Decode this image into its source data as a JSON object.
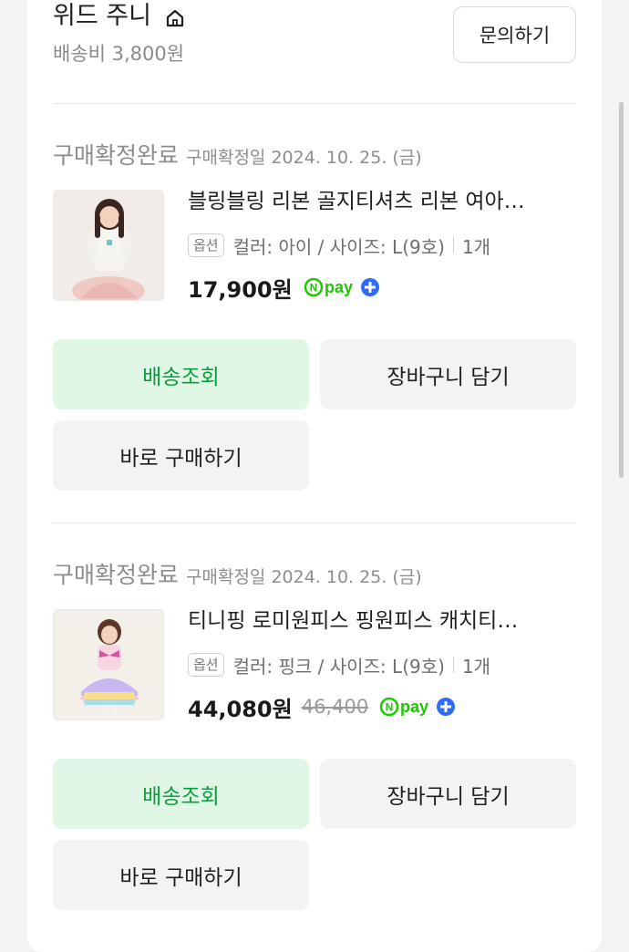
{
  "seller": {
    "name": "위드 주니",
    "shipping_fee": "배송비 3,800원",
    "inquiry_label": "문의하기"
  },
  "orders": [
    {
      "status_label": "구매확정완료",
      "status_date": "구매확정일 2024. 10. 25. (금)",
      "product_name": "블링블링 리본 골지티셔츠 리본 여아…",
      "option_badge": "옵션",
      "option_text": "컬러: 아이 / 사이즈: L(9호)",
      "quantity": "1개",
      "price": "17,900원",
      "original_price": "",
      "npay_label": "pay",
      "buttons": {
        "track": "배송조회",
        "cart": "장바구니 담기",
        "buy_again": "바로 구매하기"
      }
    },
    {
      "status_label": "구매확정완료",
      "status_date": "구매확정일 2024. 10. 25. (금)",
      "product_name": "티니핑 로미원피스 핑원피스 캐치티…",
      "option_badge": "옵션",
      "option_text": "컬러: 핑크 / 사이즈: L(9호)",
      "quantity": "1개",
      "price": "44,080원",
      "original_price": "46,400",
      "npay_label": "pay",
      "buttons": {
        "track": "배송조회",
        "cart": "장바구니 담기",
        "buy_again": "바로 구매하기"
      }
    }
  ],
  "icons": {
    "store": "home-icon",
    "npay": "npay-plus-icon"
  },
  "colors": {
    "accent_green": "#0a9e3c",
    "track_button_bg": "#dff7e4",
    "secondary_button_bg": "#f1f3f5",
    "npay_green": "#1ec800"
  }
}
